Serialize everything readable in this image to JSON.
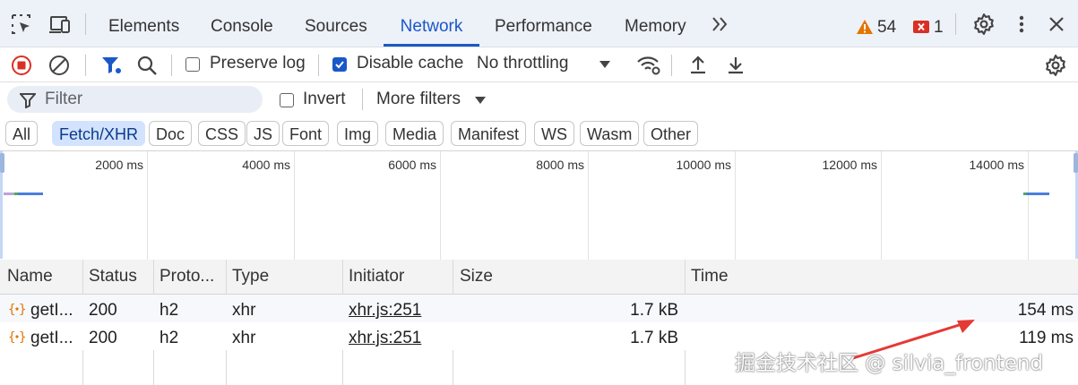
{
  "tabs": [
    {
      "label": "Elements"
    },
    {
      "label": "Console"
    },
    {
      "label": "Sources"
    },
    {
      "label": "Network"
    },
    {
      "label": "Performance"
    },
    {
      "label": "Memory"
    }
  ],
  "warnings": {
    "count": "54"
  },
  "errors": {
    "count": "1"
  },
  "toolbar": {
    "preserve_log": "Preserve log",
    "preserve_log_checked": false,
    "disable_cache": "Disable cache",
    "disable_cache_checked": true,
    "throttling": "No throttling"
  },
  "filter": {
    "placeholder": "Filter",
    "invert": "Invert",
    "more_filters": "More filters"
  },
  "type_filters": [
    "All",
    "Fetch/XHR",
    "Doc",
    "CSS",
    "JS",
    "Font",
    "Img",
    "Media",
    "Manifest",
    "WS",
    "Wasm",
    "Other"
  ],
  "selected_type_filter": "Fetch/XHR",
  "overview": {
    "time_labels": [
      "2000 ms",
      "4000 ms",
      "6000 ms",
      "8000 ms",
      "10000 ms",
      "12000 ms",
      "14000 ms"
    ]
  },
  "table": {
    "headers": [
      "Name",
      "Status",
      "Proto...",
      "Type",
      "Initiator",
      "Size",
      "Time"
    ],
    "rows": [
      {
        "name": "getI...",
        "status": "200",
        "protocol": "h2",
        "type": "xhr",
        "initiator": "xhr.js:251",
        "size": "1.7 kB",
        "time": "154 ms"
      },
      {
        "name": "getI...",
        "status": "200",
        "protocol": "h2",
        "type": "xhr",
        "initiator": "xhr.js:251",
        "size": "1.7 kB",
        "time": "119 ms"
      }
    ]
  },
  "watermark": "掘金技术社区 @ silvia_frontend",
  "colors": {
    "accent": "#1a58c8",
    "warning": "#e37400",
    "error": "#d93025",
    "annotation_arrow": "#e53935"
  }
}
